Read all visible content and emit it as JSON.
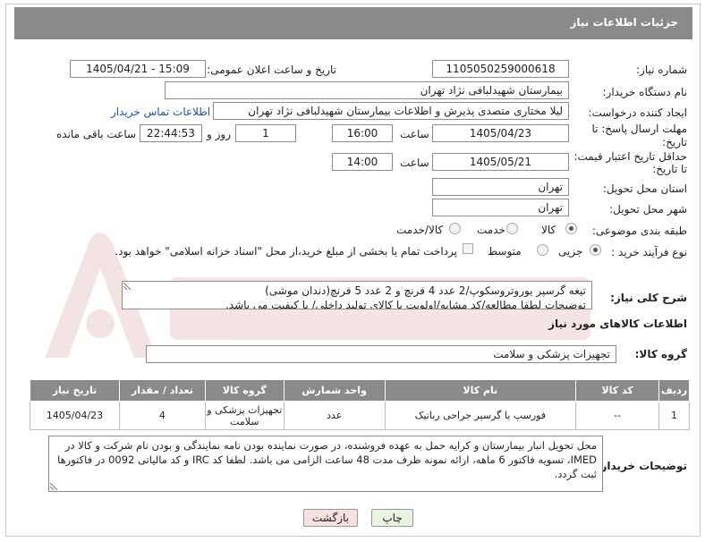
{
  "header": {
    "title": "جزئیات اطلاعات نیاز"
  },
  "fields": {
    "need_number_label": "شماره نیاز:",
    "need_number": "1105050259000618",
    "announce_label": "تاریخ و ساعت اعلان عمومی:",
    "announce_value": "1405/04/21 - 15:09",
    "buyer_org_label": "نام دستگاه خریدار:",
    "buyer_org": "بیمارستان شهیدلبافی نژاد تهران",
    "requester_label": "ایجاد کننده درخواست:",
    "requester": "لیلا مختاری متصدی پذیرش و اطلاعات بیمارستان شهیدلبافی نژاد تهران",
    "buyer_contact_link": "اطلاعات تماس خریدار",
    "deadline_label_1": "مهلت ارسال پاسخ: تا",
    "deadline_label_2": "تاریخ:",
    "deadline_date": "1405/04/23",
    "time_word": "ساعت",
    "deadline_time": "16:00",
    "days_value": "1",
    "days_label": "روز و",
    "remaining_time": "22:44:53",
    "remaining_label": "ساعت باقی مانده",
    "validity_label_1": "حداقل تاریخ اعتبار قیمت:",
    "validity_label_2": "تا تاریخ:",
    "validity_date": "1405/05/21",
    "validity_time": "14:00",
    "province_label": "استان محل تحویل:",
    "province": "تهران",
    "city_label": "شهر محل تحویل:",
    "city": "تهران",
    "category_label": "طبقه بندی موضوعی:",
    "category_options": [
      "کالا",
      "خدمت",
      "کالا/خدمت"
    ],
    "category_selected": "کالا",
    "process_label": "نوع فرآیند خرید :",
    "process_options": [
      "جزیی",
      "متوسط"
    ],
    "process_selected": "جزیی",
    "payment_note": "پرداخت تمام یا بخشی از مبلغ خرید،از محل \"اسناد خزانه اسلامی\" خواهد بود.",
    "description_label": "شرح کلی نیاز:",
    "description_line1": "تیغه گرسپر یوروتروسکوپ/2 عدد 4 فرنچ و 2 عدد 5 فرنچ(دندان موشی)",
    "description_line2": "توضیحات لطفا مطالعه/کد مشابه/اولویت با کالای تولید داخلی/ با کیفیت می باشد.",
    "goods_info_title": "اطلاعات کالاهای مورد نیاز",
    "goods_group_label": "گروه کالا:",
    "goods_group": "تجهیزات پزشکی و سلامت"
  },
  "table": {
    "headers": [
      "ردیف",
      "کد کالا",
      "نام کالا",
      "واحد شمارش",
      "گروه کالا",
      "تعداد / مقدار",
      "تاریخ نیاز"
    ],
    "rows": [
      [
        "1",
        "--",
        "فورسپ یا گرسپر جراحی رباتیک",
        "عدد",
        "تجهیزات پزشکی و سلامت",
        "4",
        "1405/04/23"
      ]
    ]
  },
  "buyer_notes": {
    "label": "توضیحات خریدار:",
    "text": "محل تحویل انبار بیمارستان و کرایه حمل به عهده فروشنده، در صورت نماینده بودن نامه نمایندگی و بودن نام شرکت و کالا در IMED، تسویه فاکتور 6 ماهه، ارائه نمونه ظرف مدت 48 ساعت الزامی می باشد. لطفا کد IRC و کد مالیاتی 0092 در فاکتورها ثبت گردد."
  },
  "buttons": {
    "print": "چاپ",
    "back": "بازگشت"
  },
  "colors": {
    "header_bg": "#8a8a8a",
    "link": "#1a54b8",
    "back_btn_bg": "#f7e0e0",
    "print_btn_bg": "#e8f3e2"
  }
}
